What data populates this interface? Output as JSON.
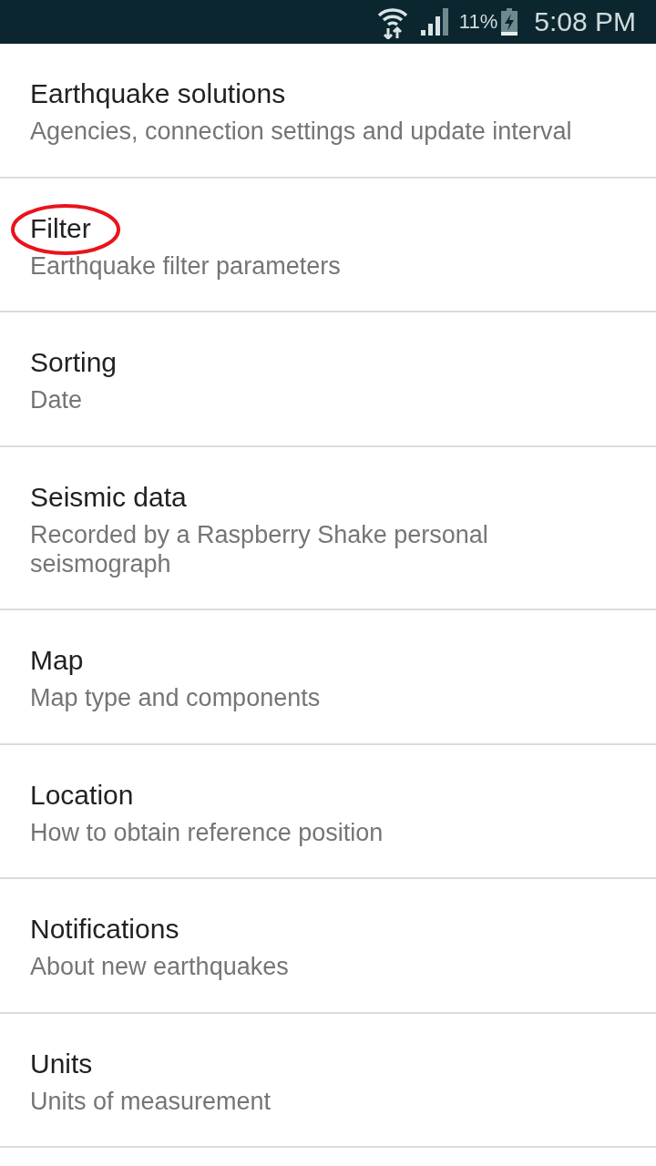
{
  "status_bar": {
    "battery": "11%",
    "time": "5:08 PM"
  },
  "items": [
    {
      "title": "Earthquake solutions",
      "summary": "Agencies, connection settings and update interval",
      "highlighted": false
    },
    {
      "title": "Filter",
      "summary": "Earthquake filter parameters",
      "highlighted": true
    },
    {
      "title": "Sorting",
      "summary": "Date",
      "highlighted": false
    },
    {
      "title": "Seismic data",
      "summary": "Recorded by a Raspberry Shake personal seismograph",
      "highlighted": false
    },
    {
      "title": "Map",
      "summary": "Map type and components",
      "highlighted": false
    },
    {
      "title": "Location",
      "summary": "How to obtain reference position",
      "highlighted": false
    },
    {
      "title": "Notifications",
      "summary": "About new earthquakes",
      "highlighted": false
    },
    {
      "title": "Units",
      "summary": "Units of measurement",
      "highlighted": false
    }
  ]
}
